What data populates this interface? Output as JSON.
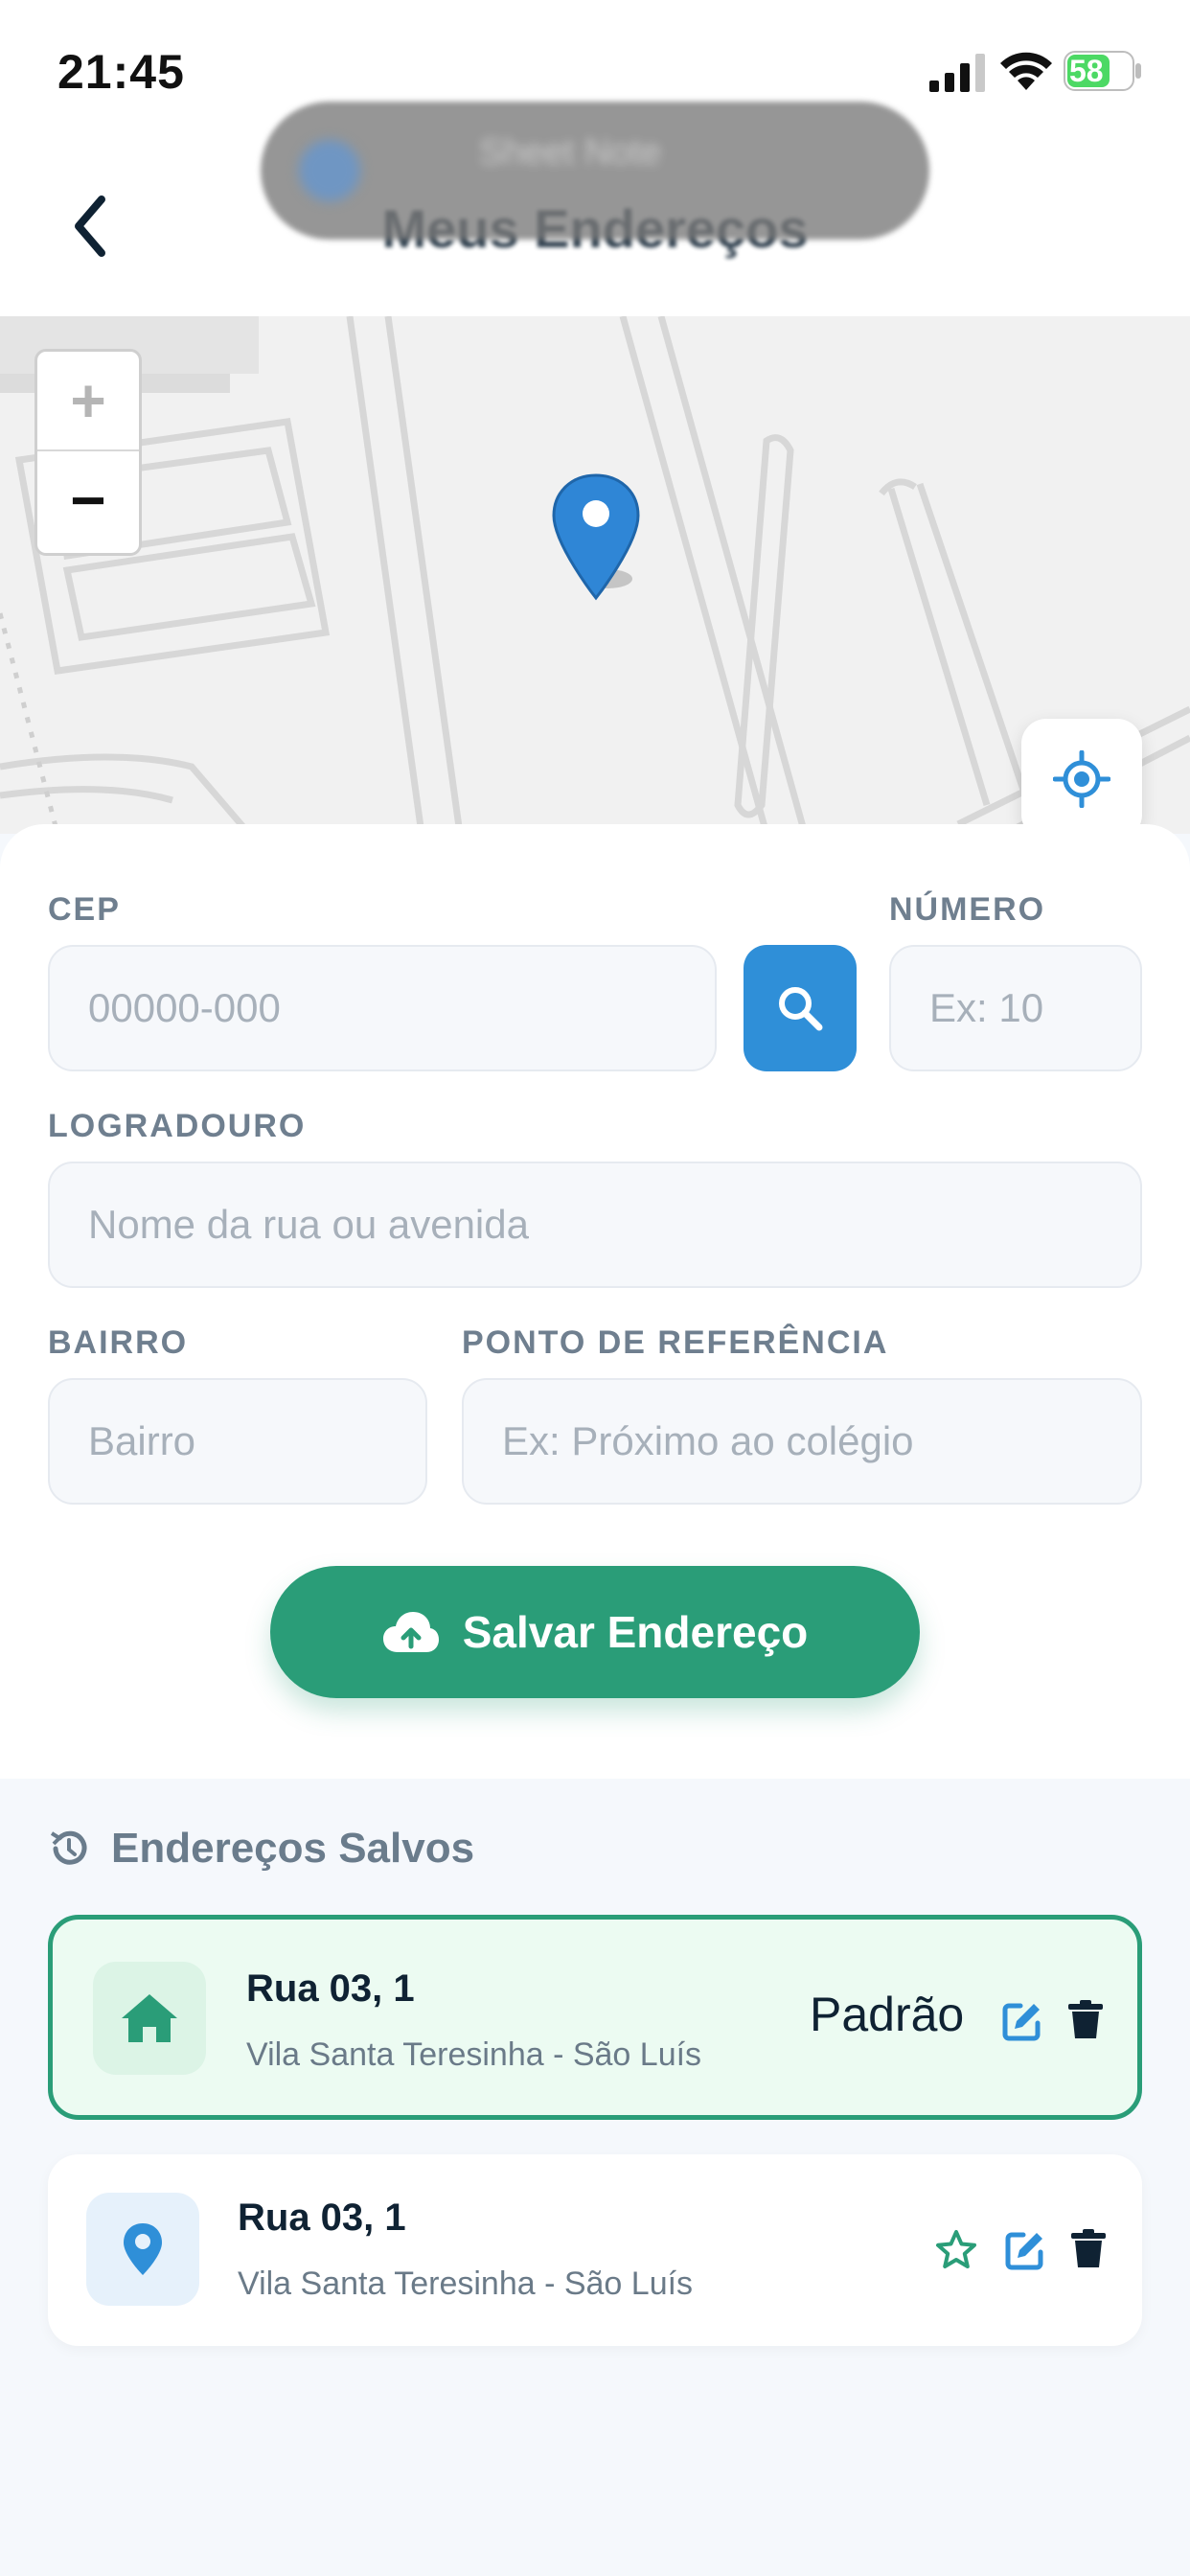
{
  "status_bar": {
    "time": "21:45",
    "battery": "58"
  },
  "header": {
    "title": "Meus Endereços",
    "overlay_text": "Sheet Note"
  },
  "map": {
    "zoom_in": "+",
    "zoom_out": "−",
    "pin_icon": "map-pin-icon",
    "locate_icon": "crosshair-icon"
  },
  "form": {
    "cep_label": "CEP",
    "cep_placeholder": "00000-000",
    "numero_label": "NÚMERO",
    "numero_placeholder": "Ex: 10",
    "logradouro_label": "LOGRADOURO",
    "logradouro_placeholder": "Nome da rua ou avenida",
    "bairro_label": "BAIRRO",
    "bairro_placeholder": "Bairro",
    "referencia_label": "PONTO DE REFERÊNCIA",
    "referencia_placeholder": "Ex: Próximo ao colégio",
    "save_label": "Salvar Endereço"
  },
  "saved": {
    "title": "Endereços Salvos",
    "items": [
      {
        "street": "Rua 03, 1",
        "area": "Vila Santa Teresinha - São Luís",
        "badge": "Padrão",
        "icon": "home-icon"
      },
      {
        "street": "Rua 03, 1",
        "area": "Vila Santa Teresinha - São Luís",
        "icon": "map-pin-icon"
      }
    ]
  },
  "colors": {
    "accent_green": "#2a9d78",
    "accent_blue": "#2f8fd8",
    "text_dark": "#0f2233"
  }
}
